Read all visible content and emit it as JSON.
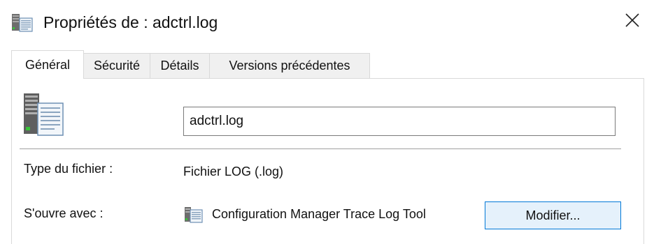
{
  "window": {
    "title": "Propriétés de : adctrl.log",
    "close_icon": "close-icon"
  },
  "tabs": [
    {
      "label": "Général",
      "active": true
    },
    {
      "label": "Sécurité",
      "active": false
    },
    {
      "label": "Détails",
      "active": false
    },
    {
      "label": "Versions précédentes",
      "active": false
    }
  ],
  "general": {
    "file_icon": "log-file-icon",
    "filename_value": "adctrl.log",
    "file_type_label": "Type du fichier :",
    "file_type_value": "Fichier LOG (.log)",
    "opens_with_label": "S'ouvre avec :",
    "opens_with_app_icon": "trace-log-tool-icon",
    "opens_with_app": "Configuration Manager Trace Log Tool",
    "modify_button_label": "Modifier..."
  },
  "colors": {
    "accent_border": "#0078d7",
    "button_bg": "#e5f1fb"
  }
}
